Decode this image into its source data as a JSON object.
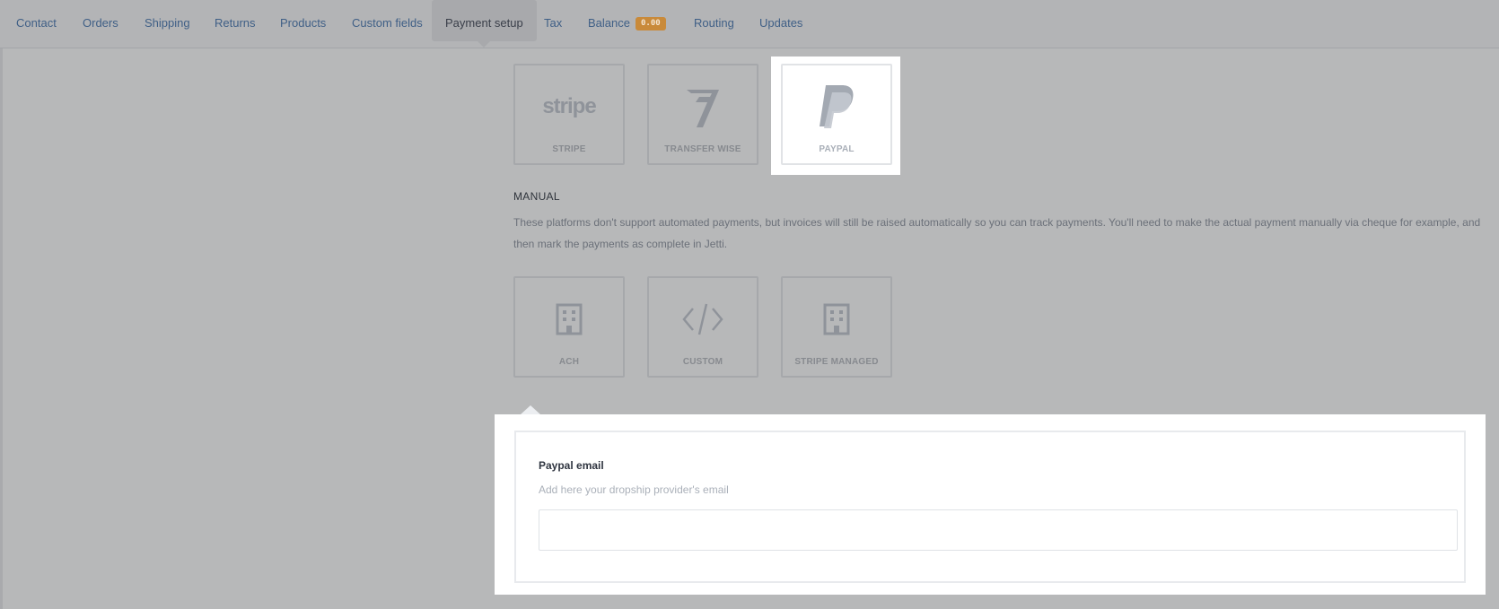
{
  "nav": {
    "items": [
      {
        "label": "Contact"
      },
      {
        "label": "Orders"
      },
      {
        "label": "Shipping"
      },
      {
        "label": "Returns"
      },
      {
        "label": "Products"
      },
      {
        "label": "Custom fields"
      },
      {
        "label": "Payment setup",
        "active": true
      },
      {
        "label": "Tax"
      },
      {
        "label": "Balance",
        "badge": "0.00"
      },
      {
        "label": "Routing"
      },
      {
        "label": "Updates"
      }
    ]
  },
  "automated_methods": [
    {
      "label": "STRIPE",
      "icon": "stripe-logo-icon",
      "logo_text": "stripe"
    },
    {
      "label": "TRANSFER WISE",
      "icon": "transferwise-logo-icon"
    },
    {
      "label": "PAYPAL",
      "icon": "paypal-logo-icon",
      "selected": true
    }
  ],
  "manual": {
    "title": "MANUAL",
    "description": "These platforms don't support automated payments, but invoices will still be raised automatically so you can track payments. You'll need to make the actual payment manually via cheque for example, and then mark the payments as complete in Jetti.",
    "methods": [
      {
        "label": "ACH",
        "icon": "building-icon"
      },
      {
        "label": "CUSTOM",
        "icon": "code-icon"
      },
      {
        "label": "STRIPE MANAGED",
        "icon": "building-icon"
      }
    ]
  },
  "paypal_form": {
    "label": "Paypal email",
    "help": "Add here your dropship provider's email",
    "value": "",
    "placeholder": ""
  },
  "colors": {
    "overlay": "#b7b8b9",
    "link": "#3f5f86",
    "badge": "#c98a3a",
    "card_border": "#a6a8ab",
    "icon_gray": "#8f939a"
  }
}
